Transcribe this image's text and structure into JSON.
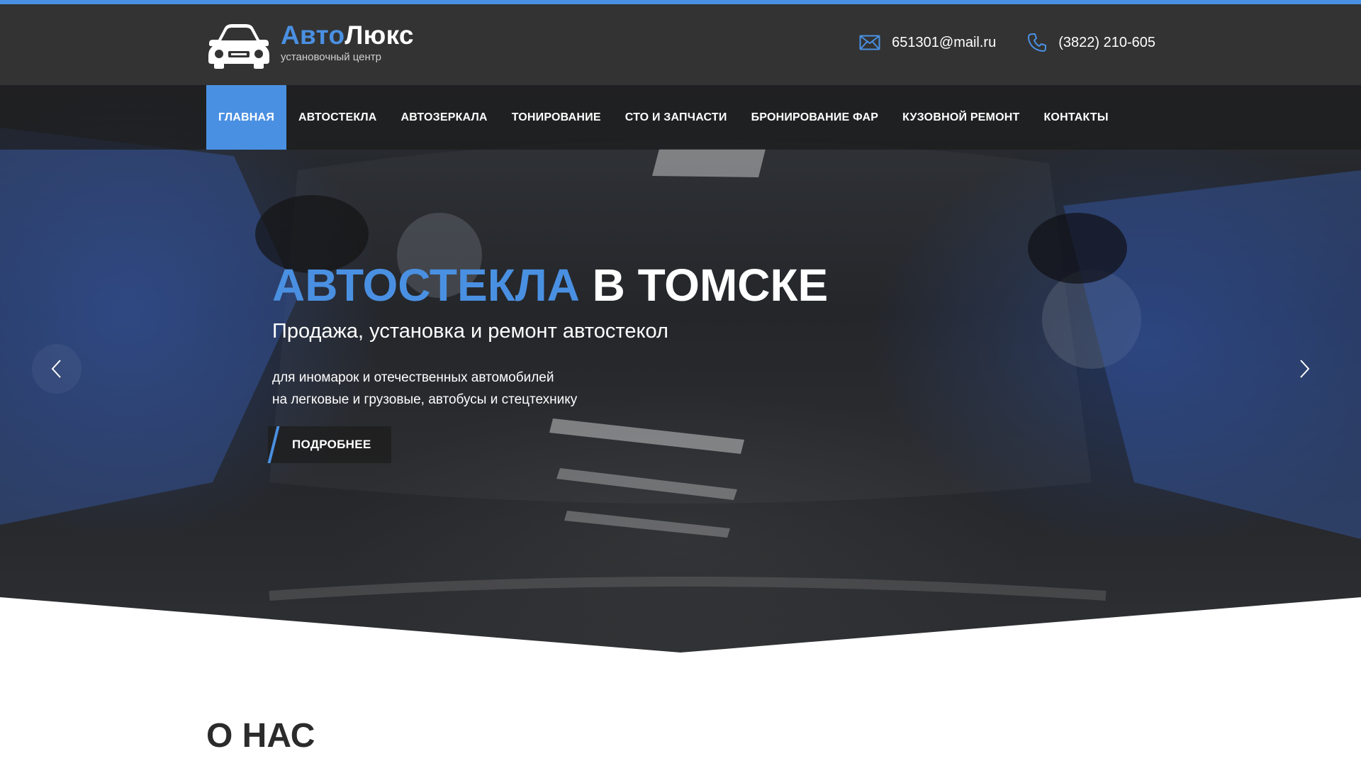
{
  "header": {
    "brand_part1": "Авто",
    "brand_part2": "Люкс",
    "tagline": "установочный центр",
    "email": "651301@mail.ru",
    "phone": "(3822) 210-605",
    "icons": {
      "logo": "car-icon",
      "email": "envelope-icon",
      "phone": "phone-icon"
    }
  },
  "nav": {
    "items": [
      {
        "label": "ГЛАВНАЯ",
        "active": true
      },
      {
        "label": "АВТОСТЕКЛА"
      },
      {
        "label": "АВТОЗЕРКАЛА"
      },
      {
        "label": "ТОНИРОВАНИЕ"
      },
      {
        "label": "СТО И ЗАПЧАСТИ"
      },
      {
        "label": "БРОНИРОВАНИЕ ФАР"
      },
      {
        "label": "КУЗОВНОЙ РЕМОНТ"
      },
      {
        "label": "КОНТАКТЫ"
      }
    ]
  },
  "hero": {
    "title_accent": "АВТОСТЕКЛА",
    "title_rest": " В ТОМСКЕ",
    "subtitle": "Продажа, установка и ремонт автостекол",
    "desc_line1": "для иномарок и отечественных автомобилей",
    "desc_line2": "на легковые и грузовые, автобусы и стецтехнику",
    "button_label": "ПОДРОБНЕЕ",
    "icons": {
      "prev": "chevron-left-icon",
      "next": "chevron-right-icon"
    }
  },
  "about": {
    "title": "О НАС"
  },
  "colors": {
    "accent": "#4a90e2",
    "header_bg": "#333333",
    "text_dark": "#2b2b2b"
  }
}
